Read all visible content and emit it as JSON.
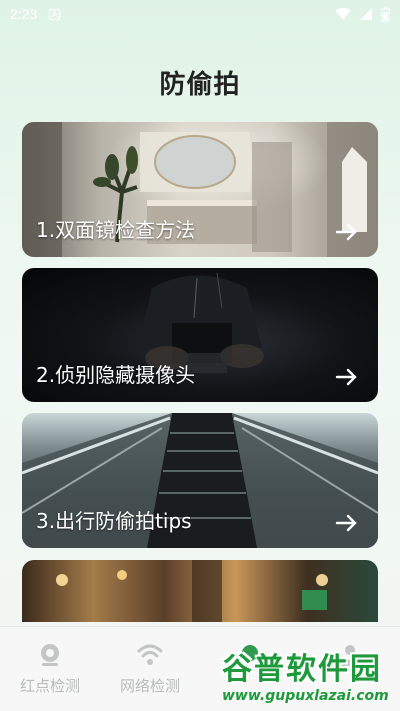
{
  "status_bar": {
    "time": "2:23",
    "notification_letter": "A",
    "icons": [
      "wifi-icon",
      "signal-icon",
      "battery-icon"
    ]
  },
  "page": {
    "title": "防偷拍"
  },
  "cards": [
    {
      "label": "1.双面镜检查方法",
      "image": "bathroom-mirror-photo"
    },
    {
      "label": "2.侦别隐藏摄像头",
      "image": "dark-hidden-camera-photo"
    },
    {
      "label": "3.出行防偷拍tips",
      "image": "escalator-photo"
    },
    {
      "label": "",
      "image": "street-night-photo"
    }
  ],
  "bottom_nav": {
    "items": [
      {
        "label": "红点检测",
        "icon": "camera-dot-icon"
      },
      {
        "label": "网络检测",
        "icon": "wifi-icon"
      },
      {
        "label": "",
        "icon": "green-shield-icon"
      },
      {
        "label": "",
        "icon": "person-icon"
      }
    ]
  },
  "watermark": {
    "text": "谷普软件园",
    "url": "www.gupuxlazai.com"
  },
  "colors": {
    "accent": "#1e9a3c",
    "nav_inactive": "#b9bcbb",
    "background_top": "#dff3e6"
  }
}
